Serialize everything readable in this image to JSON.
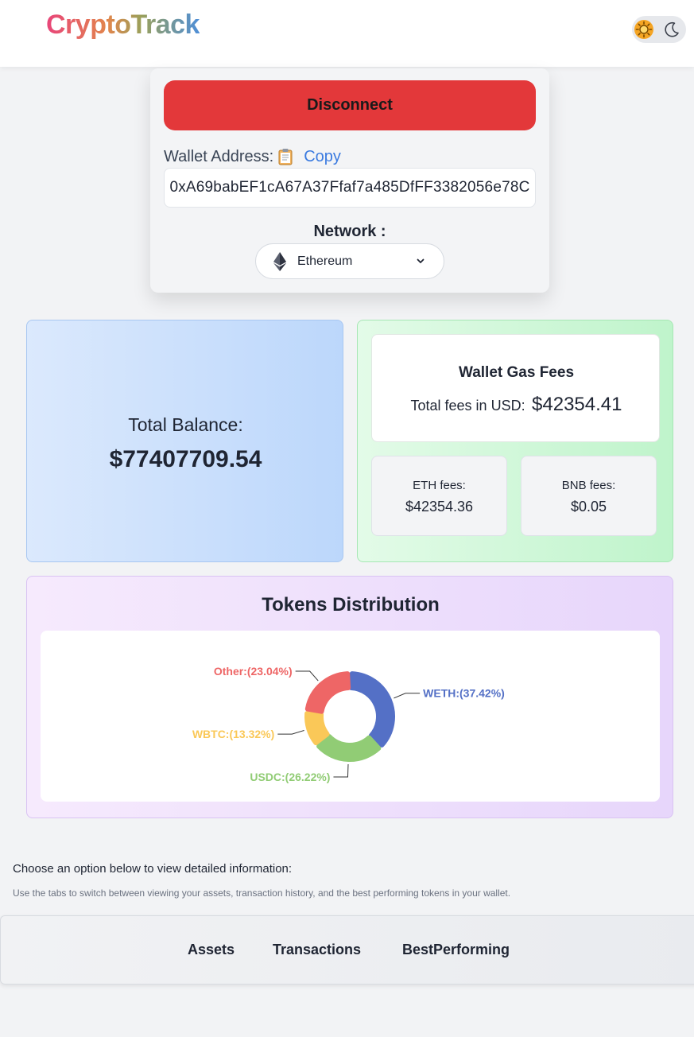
{
  "header": {
    "logo": "CryptoTrack"
  },
  "theme_toggle": {
    "light_icon": "sun-icon",
    "dark_icon": "moon-icon"
  },
  "wallet": {
    "disconnect_label": "Disconnect",
    "address_label": "Wallet Address:",
    "copy_label": "Copy",
    "address": "0xA69babEF1cA67A37Ffaf7a485DfFF3382056e78C",
    "network_label": "Network :",
    "network_value": "Ethereum"
  },
  "balance": {
    "label": "Total Balance:",
    "value": "$77407709.54"
  },
  "gas": {
    "title": "Wallet Gas Fees",
    "total_label": "Total fees in USD:",
    "total_value": "$42354.41",
    "eth_label": "ETH fees:",
    "eth_value": "$42354.36",
    "bnb_label": "BNB fees:",
    "bnb_value": "$0.05"
  },
  "tokens": {
    "title": "Tokens Distribution"
  },
  "chart_data": {
    "type": "pie",
    "title": "Tokens Distribution",
    "slices": [
      {
        "name": "WETH",
        "value": 37.42,
        "label": "WETH:(37.42%)",
        "color": "#5470c6"
      },
      {
        "name": "USDC",
        "value": 26.22,
        "label": "USDC:(26.22%)",
        "color": "#91cc75"
      },
      {
        "name": "WBTC",
        "value": 13.32,
        "label": "WBTC:(13.32%)",
        "color": "#fac858"
      },
      {
        "name": "Other",
        "value": 23.04,
        "label": "Other:(23.04%)",
        "color": "#ee6666"
      }
    ]
  },
  "info": {
    "heading": "Choose an option below to view detailed information:",
    "subtext": "Use the tabs to switch between viewing your assets, transaction history, and the best performing tokens in your wallet."
  },
  "tabs": [
    {
      "label": "Assets"
    },
    {
      "label": "Transactions"
    },
    {
      "label": "BestPerforming"
    }
  ],
  "colors": {
    "disconnect": "#e3383a",
    "link": "#3b7be0"
  }
}
